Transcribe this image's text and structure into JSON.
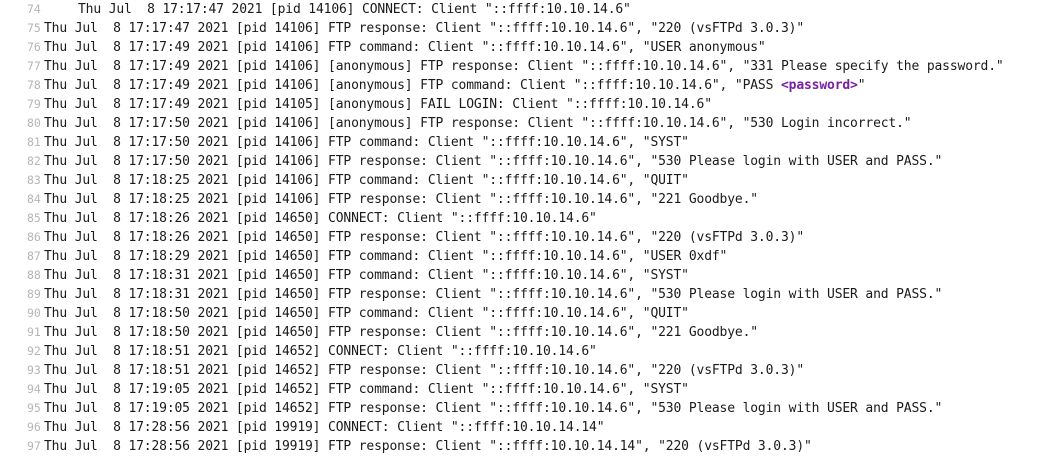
{
  "log": {
    "lines": [
      {
        "num": "74",
        "text": "Thu Jul  8 17:17:47 2021 [pid 14106] CONNECT: Client \"::ffff:10.10.14.6\""
      },
      {
        "num": "75",
        "text": "Thu Jul  8 17:17:47 2021 [pid 14106] FTP response: Client \"::ffff:10.10.14.6\", \"220 (vsFTPd 3.0.3)\""
      },
      {
        "num": "76",
        "text": "Thu Jul  8 17:17:49 2021 [pid 14106] FTP command: Client \"::ffff:10.10.14.6\", \"USER anonymous\""
      },
      {
        "num": "77",
        "text": "Thu Jul  8 17:17:49 2021 [pid 14106] [anonymous] FTP response: Client \"::ffff:10.10.14.6\", \"331 Please specify the password.\""
      },
      {
        "num": "78",
        "text_pre": "Thu Jul  8 17:17:49 2021 [pid 14106] [anonymous] FTP command: Client \"::ffff:10.10.14.6\", \"PASS ",
        "highlight": "<password>",
        "text_post": "\""
      },
      {
        "num": "79",
        "text": "Thu Jul  8 17:17:49 2021 [pid 14105] [anonymous] FAIL LOGIN: Client \"::ffff:10.10.14.6\""
      },
      {
        "num": "80",
        "text": "Thu Jul  8 17:17:50 2021 [pid 14106] [anonymous] FTP response: Client \"::ffff:10.10.14.6\", \"530 Login incorrect.\""
      },
      {
        "num": "81",
        "text": "Thu Jul  8 17:17:50 2021 [pid 14106] FTP command: Client \"::ffff:10.10.14.6\", \"SYST\""
      },
      {
        "num": "82",
        "text": "Thu Jul  8 17:17:50 2021 [pid 14106] FTP response: Client \"::ffff:10.10.14.6\", \"530 Please login with USER and PASS.\""
      },
      {
        "num": "83",
        "text": "Thu Jul  8 17:18:25 2021 [pid 14106] FTP command: Client \"::ffff:10.10.14.6\", \"QUIT\""
      },
      {
        "num": "84",
        "text": "Thu Jul  8 17:18:25 2021 [pid 14106] FTP response: Client \"::ffff:10.10.14.6\", \"221 Goodbye.\""
      },
      {
        "num": "85",
        "text": "Thu Jul  8 17:18:26 2021 [pid 14650] CONNECT: Client \"::ffff:10.10.14.6\""
      },
      {
        "num": "86",
        "text": "Thu Jul  8 17:18:26 2021 [pid 14650] FTP response: Client \"::ffff:10.10.14.6\", \"220 (vsFTPd 3.0.3)\""
      },
      {
        "num": "87",
        "text": "Thu Jul  8 17:18:29 2021 [pid 14650] FTP command: Client \"::ffff:10.10.14.6\", \"USER 0xdf\""
      },
      {
        "num": "88",
        "text": "Thu Jul  8 17:18:31 2021 [pid 14650] FTP command: Client \"::ffff:10.10.14.6\", \"SYST\""
      },
      {
        "num": "89",
        "text": "Thu Jul  8 17:18:31 2021 [pid 14650] FTP response: Client \"::ffff:10.10.14.6\", \"530 Please login with USER and PASS.\""
      },
      {
        "num": "90",
        "text": "Thu Jul  8 17:18:50 2021 [pid 14650] FTP command: Client \"::ffff:10.10.14.6\", \"QUIT\""
      },
      {
        "num": "91",
        "text": "Thu Jul  8 17:18:50 2021 [pid 14650] FTP response: Client \"::ffff:10.10.14.6\", \"221 Goodbye.\""
      },
      {
        "num": "92",
        "text": "Thu Jul  8 17:18:51 2021 [pid 14652] CONNECT: Client \"::ffff:10.10.14.6\""
      },
      {
        "num": "93",
        "text": "Thu Jul  8 17:18:51 2021 [pid 14652] FTP response: Client \"::ffff:10.10.14.6\", \"220 (vsFTPd 3.0.3)\""
      },
      {
        "num": "94",
        "text": "Thu Jul  8 17:19:05 2021 [pid 14652] FTP command: Client \"::ffff:10.10.14.6\", \"SYST\""
      },
      {
        "num": "95",
        "text": "Thu Jul  8 17:19:05 2021 [pid 14652] FTP response: Client \"::ffff:10.10.14.6\", \"530 Please login with USER and PASS.\""
      },
      {
        "num": "96",
        "text": "Thu Jul  8 17:28:56 2021 [pid 19919] CONNECT: Client \"::ffff:10.10.14.14\""
      },
      {
        "num": "97",
        "text": "Thu Jul  8 17:28:56 2021 [pid 19919] FTP response: Client \"::ffff:10.10.14.14\", \"220 (vsFTPd 3.0.3)\""
      }
    ]
  },
  "colors": {
    "background": "#ffffff",
    "text": "#1a1a1a",
    "line_number": "#b5b5b5",
    "highlight": "#7a1fa2"
  }
}
